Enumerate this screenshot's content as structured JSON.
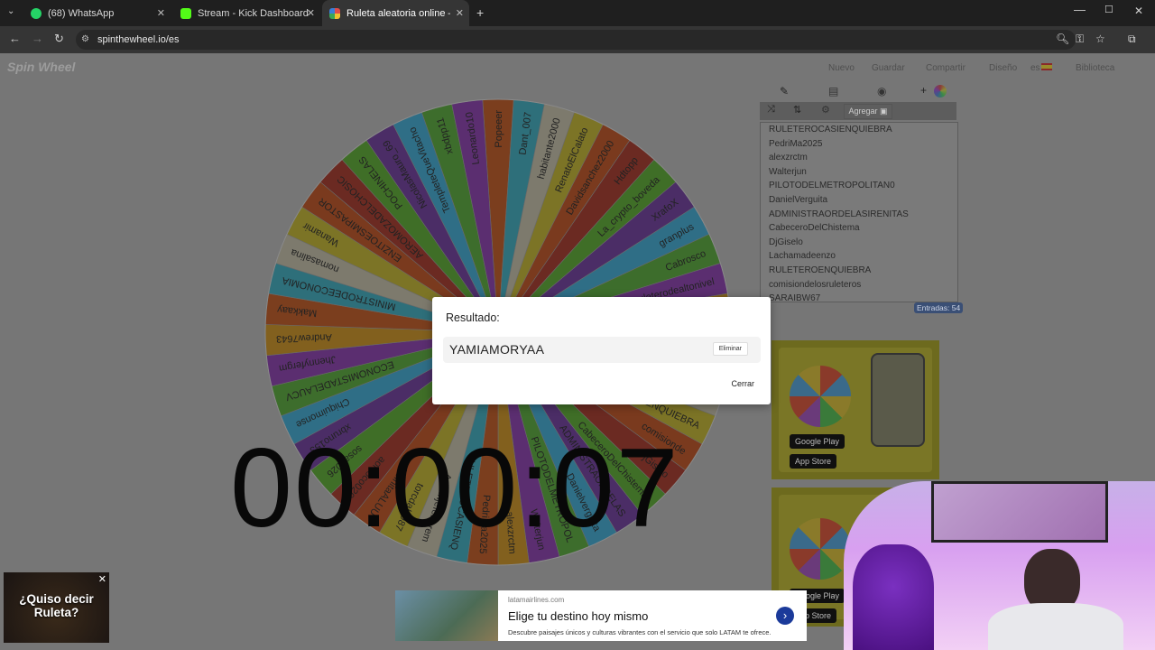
{
  "tabs": [
    {
      "title": "(68) WhatsApp",
      "color": "#25D366"
    },
    {
      "title": "Stream - Kick Dashboard",
      "color": "#53FC18"
    },
    {
      "title": "Ruleta aleatoria online – ruleta",
      "color": "#e04b4b"
    }
  ],
  "url": "spinthewheel.io/es",
  "logo": "Spin Wheel",
  "top_links": [
    "Nuevo",
    "Guardar",
    "Compartir",
    "Diseño",
    "es",
    "Biblioteca"
  ],
  "panel": {
    "agregar": "Agregar",
    "entries_label": "Entradas: 54"
  },
  "entries": [
    "RULETEROCASIENQUIEBRA",
    "PedriMa2025",
    "alexzrctm",
    "Walterjun",
    "PILOTODELMETROPOLITAN0",
    "DanielVerguita",
    "ADMINISTRAORDELASIRENITAS",
    "CabeceroDelChistema",
    "DjGiselo",
    "Lachamadeenzo",
    "RULETEROENQUIEBRA",
    "comisiondelosruleteros",
    "SARAIBW67"
  ],
  "wheel_labels": [
    "Popeeer",
    "Dant_007",
    "habitante2000",
    "RenatoElCalato",
    "Davidsanchez2000",
    "Hdtopp",
    "La_crypto_boveda",
    "XrafoX",
    "granplus",
    "Cabrosco",
    "ruleterodealtonivel",
    "Lildpopaaa",
    "Lareina1329",
    "senseydel",
    "SARAIBW67",
    "RULETEROENQUIEBRA",
    "comisionde",
    "DjGiselo",
    "CabeceroDelChistema",
    "ADMINISTRAORDELAS",
    "Danielverguita",
    "PILOTODELMETROPOL",
    "Walterjun",
    "alexzrctm",
    "PedriMa2025",
    "RULETEROCASIENQ",
    "Adminjefeharem",
    "torcdal1987",
    "ReinitaALUU",
    "aorsoco020",
    "sosa2026",
    "xbruno153",
    "Chiquimonse",
    "ECONOMISTADELAUCV",
    "Jhennyfergm",
    "Andrew7643",
    "Makkaay",
    "MINISTRODEECONOMIA",
    "nomasalina",
    "Wanamir",
    "ENZITOESMIPASTOR",
    "AEROMOZADELCHOSIC",
    "POCHINELAS",
    "NicolasMauro_69",
    "TempleteQueVitacho",
    "xbdpp11",
    "Leonardo10"
  ],
  "modal": {
    "title": "Resultado:",
    "result": "YAMIAMORYAA",
    "eliminar": "Eliminar",
    "cerrar": "Cerrar"
  },
  "timer": "00:00:07",
  "bottom_ad": {
    "domain": "latamairlines.com",
    "headline": "Elige tu destino hoy mismo",
    "sub": "Descubre paisajes únicos y culturas vibrantes con el servicio que solo LATAM te ofrece."
  },
  "ruleta_ad": "¿Quiso decir Ruleta?",
  "store_buttons": [
    "Google Play",
    "App Store"
  ],
  "ad_brand": "Spin Wheel"
}
